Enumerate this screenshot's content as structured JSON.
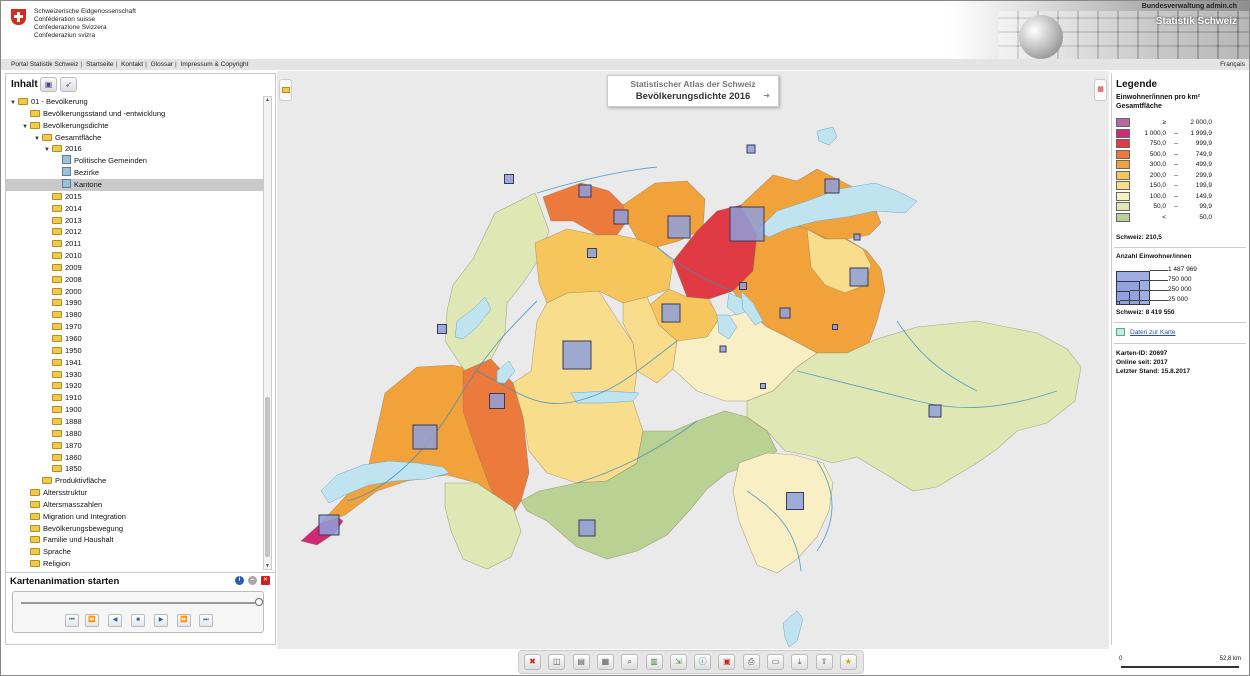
{
  "header": {
    "confederation": [
      "Schweizerische Eidgenossenschaft",
      "Confédération suisse",
      "Confederazione Svizzera",
      "Confederaziun svizra"
    ],
    "site_link": "Bundesverwaltung admin.ch",
    "portal_title": "Statistik Schweiz"
  },
  "nav": {
    "items": [
      "Portal Statistik Schweiz",
      "Startseite",
      "Kontakt",
      "Glossar",
      "Impressum & Copyright"
    ],
    "language": "Français"
  },
  "sidebar": {
    "title": "Inhalt",
    "tree": [
      {
        "label": "01 - Bevölkerung",
        "level": 0,
        "twisty": "open",
        "icon": "folder-icon"
      },
      {
        "label": "Bevölkerungsstand und -entwicklung",
        "level": 1,
        "twisty": "",
        "icon": "folder-icon"
      },
      {
        "label": "Bevölkerungsdichte",
        "level": 1,
        "twisty": "open",
        "icon": "folder-icon"
      },
      {
        "label": "Gesamtfläche",
        "level": 2,
        "twisty": "open",
        "icon": "folder-icon"
      },
      {
        "label": "2016",
        "level": 3,
        "twisty": "open",
        "icon": "folder-icon"
      },
      {
        "label": "Politische Gemeinden",
        "level": 4,
        "twisty": "",
        "icon": "map-icon"
      },
      {
        "label": "Bezirke",
        "level": 4,
        "twisty": "",
        "icon": "map-icon"
      },
      {
        "label": "Kantone",
        "level": 4,
        "twisty": "",
        "icon": "map-icon",
        "selected": true
      },
      {
        "label": "2015",
        "level": 3,
        "twisty": "",
        "icon": "folder-icon"
      },
      {
        "label": "2014",
        "level": 3,
        "twisty": "",
        "icon": "folder-icon"
      },
      {
        "label": "2013",
        "level": 3,
        "twisty": "",
        "icon": "folder-icon"
      },
      {
        "label": "2012",
        "level": 3,
        "twisty": "",
        "icon": "folder-icon"
      },
      {
        "label": "2011",
        "level": 3,
        "twisty": "",
        "icon": "folder-icon"
      },
      {
        "label": "2010",
        "level": 3,
        "twisty": "",
        "icon": "folder-icon"
      },
      {
        "label": "2009",
        "level": 3,
        "twisty": "",
        "icon": "folder-icon"
      },
      {
        "label": "2008",
        "level": 3,
        "twisty": "",
        "icon": "folder-icon"
      },
      {
        "label": "2000",
        "level": 3,
        "twisty": "",
        "icon": "folder-icon"
      },
      {
        "label": "1990",
        "level": 3,
        "twisty": "",
        "icon": "folder-icon"
      },
      {
        "label": "1980",
        "level": 3,
        "twisty": "",
        "icon": "folder-icon"
      },
      {
        "label": "1970",
        "level": 3,
        "twisty": "",
        "icon": "folder-icon"
      },
      {
        "label": "1960",
        "level": 3,
        "twisty": "",
        "icon": "folder-icon"
      },
      {
        "label": "1950",
        "level": 3,
        "twisty": "",
        "icon": "folder-icon"
      },
      {
        "label": "1941",
        "level": 3,
        "twisty": "",
        "icon": "folder-icon"
      },
      {
        "label": "1930",
        "level": 3,
        "twisty": "",
        "icon": "folder-icon"
      },
      {
        "label": "1920",
        "level": 3,
        "twisty": "",
        "icon": "folder-icon"
      },
      {
        "label": "1910",
        "level": 3,
        "twisty": "",
        "icon": "folder-icon"
      },
      {
        "label": "1900",
        "level": 3,
        "twisty": "",
        "icon": "folder-icon"
      },
      {
        "label": "1888",
        "level": 3,
        "twisty": "",
        "icon": "folder-icon"
      },
      {
        "label": "1880",
        "level": 3,
        "twisty": "",
        "icon": "folder-icon"
      },
      {
        "label": "1870",
        "level": 3,
        "twisty": "",
        "icon": "folder-icon"
      },
      {
        "label": "1860",
        "level": 3,
        "twisty": "",
        "icon": "folder-icon"
      },
      {
        "label": "1850",
        "level": 3,
        "twisty": "",
        "icon": "folder-icon"
      },
      {
        "label": "Produktivfläche",
        "level": 2,
        "twisty": "",
        "icon": "folder-icon"
      },
      {
        "label": "Altersstruktur",
        "level": 1,
        "twisty": "",
        "icon": "folder-icon"
      },
      {
        "label": "Altersmasszahlen",
        "level": 1,
        "twisty": "",
        "icon": "folder-icon"
      },
      {
        "label": "Migration und Integration",
        "level": 1,
        "twisty": "",
        "icon": "folder-icon"
      },
      {
        "label": "Bevölkerungsbewegung",
        "level": 1,
        "twisty": "",
        "icon": "folder-icon"
      },
      {
        "label": "Familie und Haushalt",
        "level": 1,
        "twisty": "",
        "icon": "folder-icon"
      },
      {
        "label": "Sprache",
        "level": 1,
        "twisty": "",
        "icon": "folder-icon"
      },
      {
        "label": "Religion",
        "level": 1,
        "twisty": "",
        "icon": "folder-icon"
      }
    ]
  },
  "animation": {
    "title": "Kartenanimation starten",
    "slider_value": 1.0,
    "buttons": [
      "first-icon",
      "prev-step-icon",
      "back-icon",
      "stop-icon",
      "play-icon",
      "next-step-icon",
      "last-icon"
    ]
  },
  "map": {
    "title_line1": "Statistischer Atlas der Schweiz",
    "title_line2": "Bevölkerungsdichte 2016"
  },
  "toolbar": {
    "buttons": [
      "close-icon",
      "layers-icon",
      "print-preview-icon",
      "table-icon",
      "zoom-icon",
      "chart-icon",
      "export-icon",
      "info-icon",
      "pdf-icon",
      "print-icon",
      "image-icon",
      "download-icon",
      "share-icon",
      "favorite-icon"
    ]
  },
  "legend": {
    "title": "Legende",
    "subtitle": "Einwohner/innen pro km² Gesamtfläche",
    "classes": [
      {
        "lo": "≥",
        "dash": "",
        "hi": "2 000,0",
        "color": "#b569a3"
      },
      {
        "lo": "1 000,0",
        "dash": "–",
        "hi": "1 999,9",
        "color": "#d1287a"
      },
      {
        "lo": "750,0",
        "dash": "–",
        "hi": "999,9",
        "color": "#e03a45"
      },
      {
        "lo": "500,0",
        "dash": "–",
        "hi": "749,9",
        "color": "#ec7a3c"
      },
      {
        "lo": "300,0",
        "dash": "–",
        "hi": "499,9",
        "color": "#f1a23a"
      },
      {
        "lo": "200,0",
        "dash": "–",
        "hi": "299,9",
        "color": "#f6c65c"
      },
      {
        "lo": "150,0",
        "dash": "–",
        "hi": "199,9",
        "color": "#f8dd8d"
      },
      {
        "lo": "100,0",
        "dash": "–",
        "hi": "149,9",
        "color": "#f8efc4"
      },
      {
        "lo": "50,0",
        "dash": "–",
        "hi": "99,9",
        "color": "#dfe8b4"
      },
      {
        "lo": "<",
        "dash": "",
        "hi": "50,0",
        "color": "#b9d192"
      }
    ],
    "ch_density_label": "Schweiz: 210,5",
    "pop_title": "Anzahl Einwohner/innen",
    "pop_classes": [
      "1 487 969",
      "750 000",
      "250 000",
      "25 000"
    ],
    "pop_values": [
      1487969,
      750000,
      250000,
      25000
    ],
    "ch_pop_label": "Schweiz: 8 419 550",
    "data_link": "Daten zur Karte",
    "map_id": "Karten-ID: 20697",
    "online_since": "Online seit: 2017",
    "last_status": "Letzter Stand: 15.8.2017",
    "lake_color": "#bfe3ef",
    "symbol_color": "#8ea0dc"
  },
  "scale": {
    "start": "0",
    "end": "52,8 km"
  }
}
